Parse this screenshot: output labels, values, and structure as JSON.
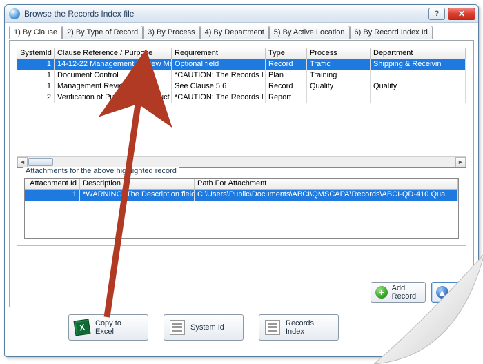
{
  "window": {
    "title": "Browse the Records Index file"
  },
  "tabs": [
    {
      "label": "1) By Clause",
      "active": true
    },
    {
      "label": "2) By Type of Record"
    },
    {
      "label": "3) By Process"
    },
    {
      "label": "4) By Department"
    },
    {
      "label": "5) By Active Location"
    },
    {
      "label": "6) By Record Index Id"
    }
  ],
  "records_grid": {
    "columns": {
      "sysid": "SystemId",
      "clause": "Clause Reference / Purpose",
      "req": "Requirement",
      "type": "Type",
      "proc": "Process",
      "dept": "Department"
    },
    "rows": [
      {
        "sysid": "1",
        "clause": "14-12-22 Management Review Me",
        "req": "Optional field",
        "type": "Record",
        "proc": "Traffic",
        "dept": "Shipping & Receivin",
        "selected": true
      },
      {
        "sysid": "1",
        "clause": "Document Control",
        "req": "*CAUTION: The Records I",
        "type": "Plan",
        "proc": "Training",
        "dept": ""
      },
      {
        "sysid": "1",
        "clause": "Management Review Minutes",
        "req": "See Clause 5.6",
        "type": "Record",
        "proc": "Quality",
        "dept": "Quality"
      },
      {
        "sysid": "2",
        "clause": "Verification of Purchased Product",
        "req": "*CAUTION: The Records I",
        "type": "Report",
        "proc": "",
        "dept": ""
      }
    ]
  },
  "attachments": {
    "legend": "Attachments for the above highlighted record",
    "columns": {
      "id": "Attachment Id",
      "desc": "Description",
      "path": "Path For Attachment"
    },
    "rows": [
      {
        "id": "1",
        "desc": "*WARNING: The Description field",
        "path": "C:\\Users\\Public\\Documents\\ABCI\\QMSCAPA\\Records\\ABCI-QD-410 Qua",
        "selected": true
      }
    ]
  },
  "buttons": {
    "add_record": "Add\nRecord",
    "edit": "E",
    "copy_excel": "Copy to\nExcel",
    "system_id": "System Id",
    "records_index": "Records\nIndex"
  }
}
